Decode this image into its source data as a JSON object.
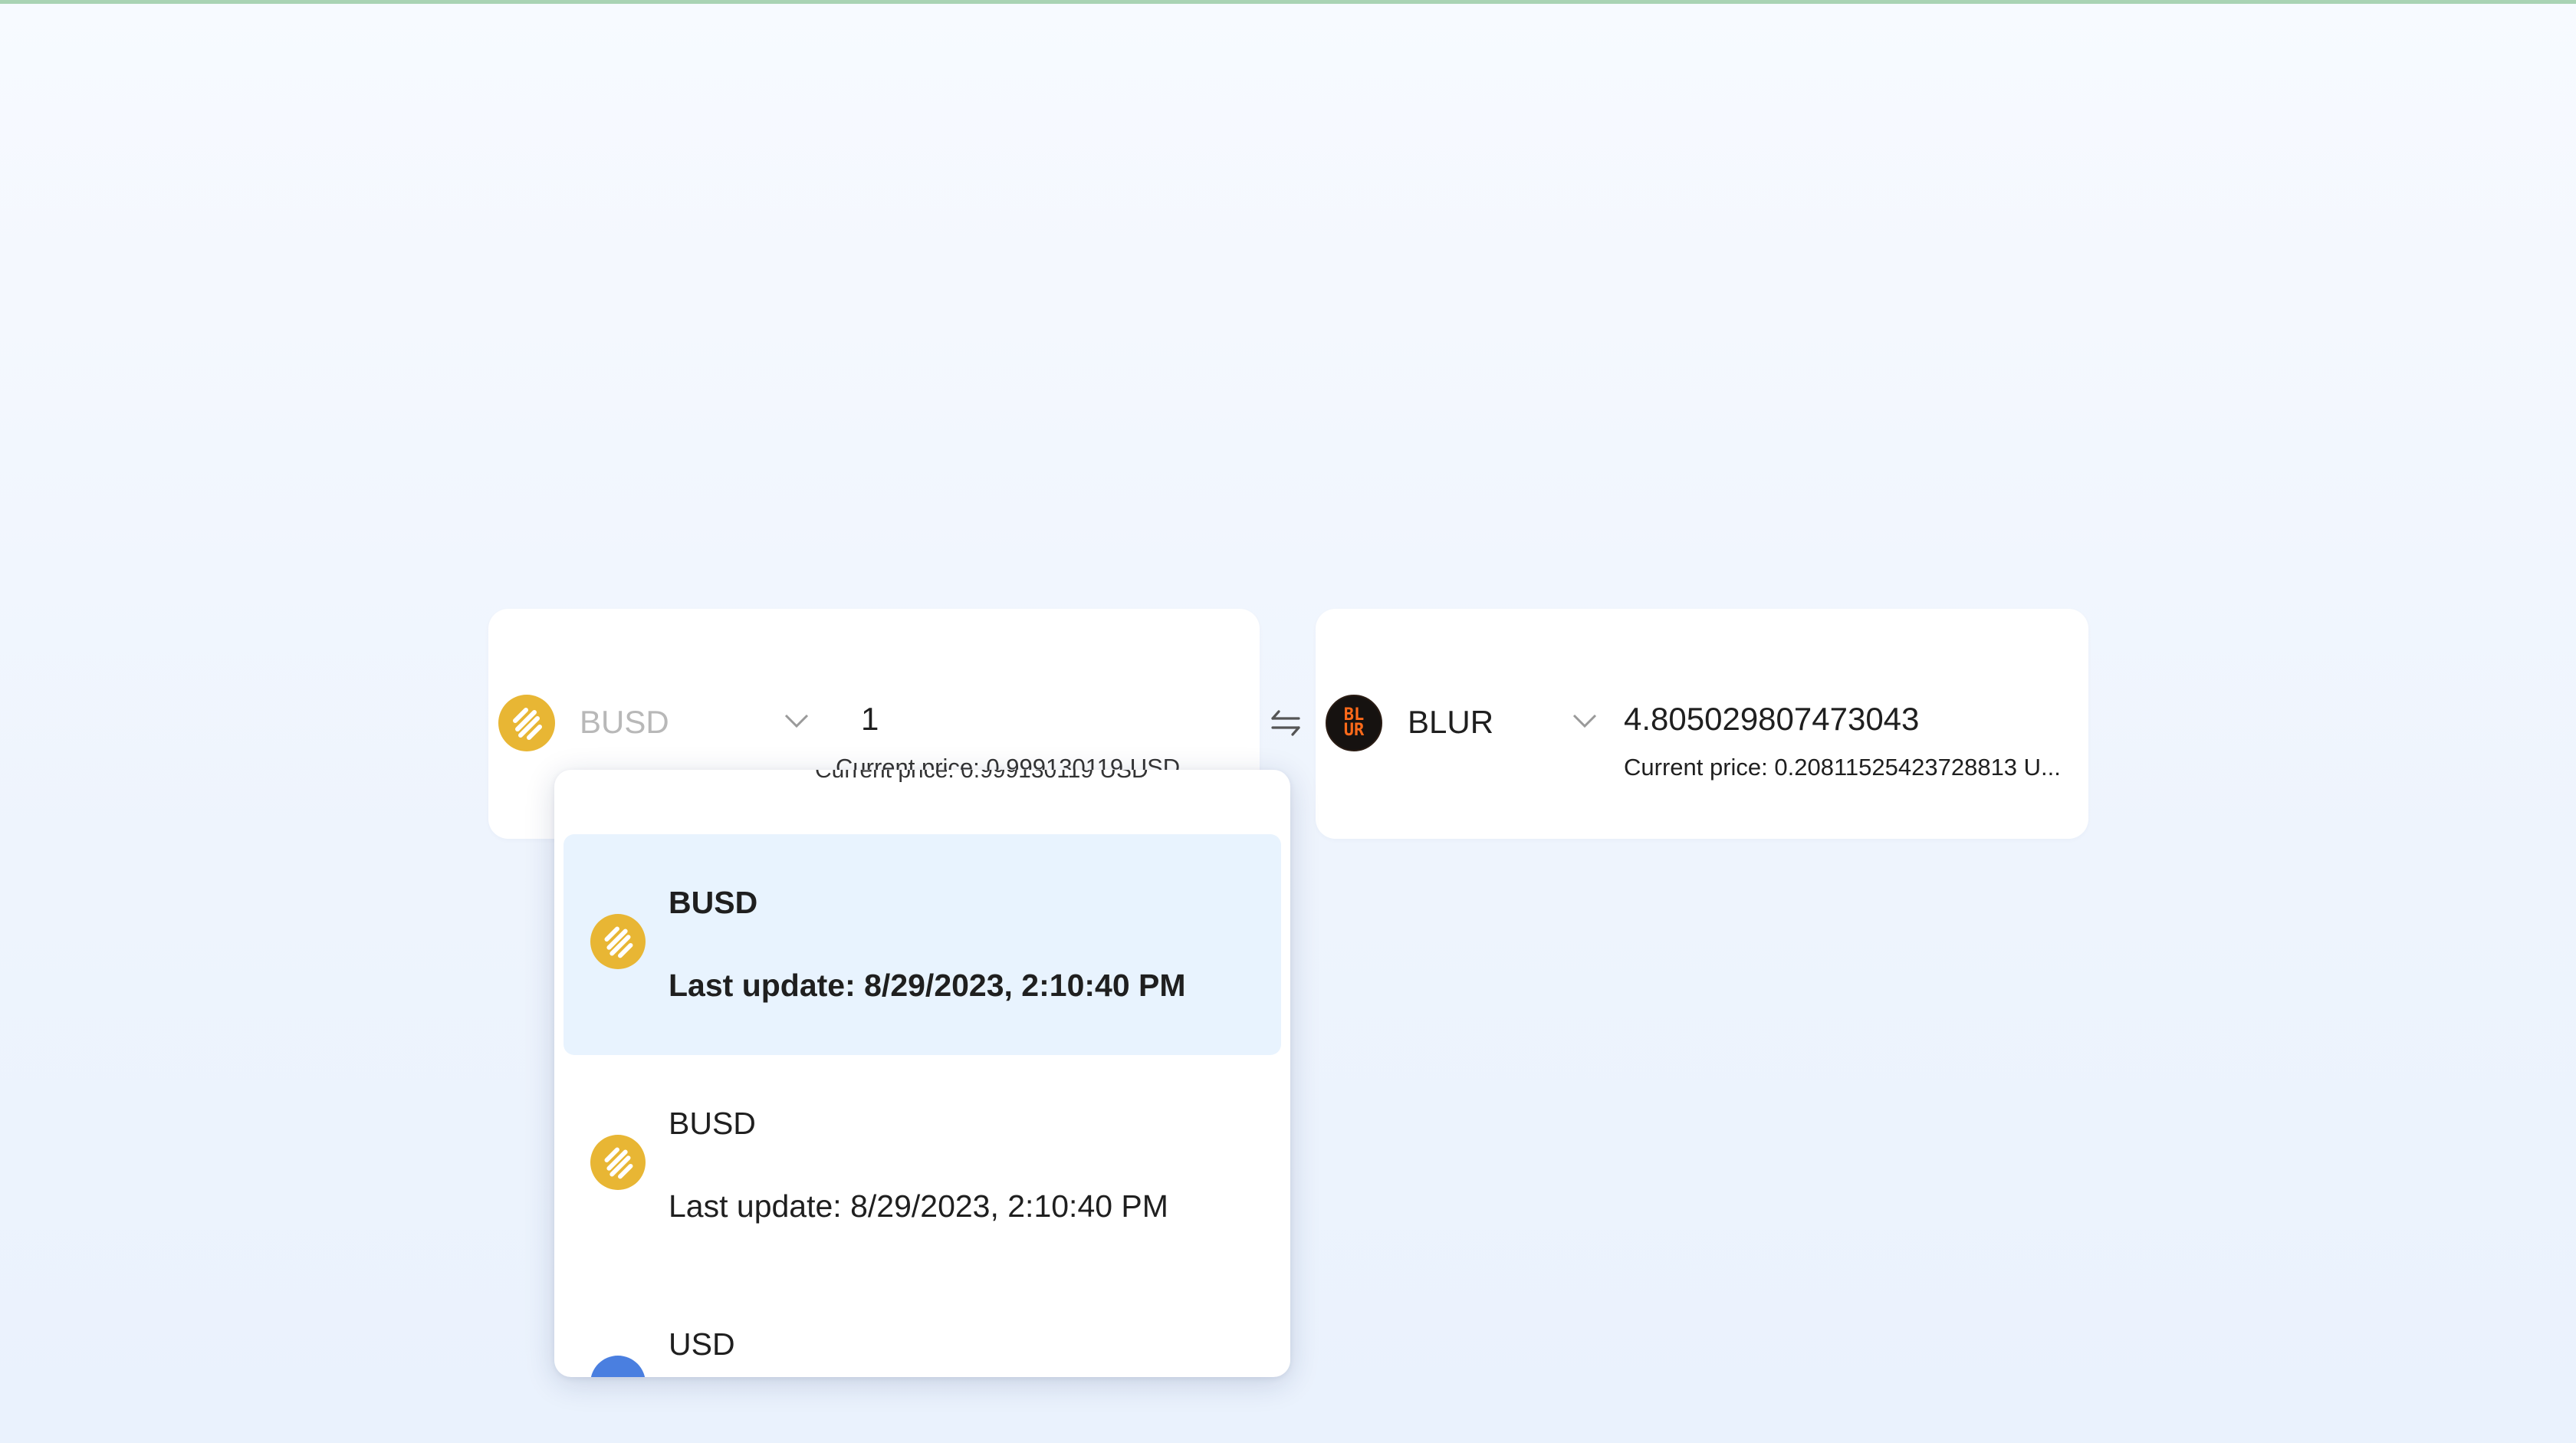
{
  "from": {
    "token": "BUSD",
    "amount": "1",
    "price_partial": "Current price: 0.999130119 USD"
  },
  "to": {
    "token": "BLUR",
    "amount": "4.805029807473043",
    "price": "Current price: 0.20811525423728813 U..."
  },
  "swap_icon": "swap-arrows-icon",
  "dropdown": {
    "options": [
      {
        "symbol": "BUSD",
        "update": "Last update: 8/29/2023, 2:10:40 PM",
        "selected": true
      },
      {
        "symbol": "BUSD",
        "update": "Last update: 8/29/2023, 2:10:40 PM",
        "selected": false
      },
      {
        "symbol": "USD",
        "update": "",
        "selected": false
      }
    ]
  },
  "colors": {
    "busd": "#e8b634",
    "blur": "#ff6a1a",
    "selected_bg": "#e8f3fe",
    "usd": "#4a7fe0"
  }
}
